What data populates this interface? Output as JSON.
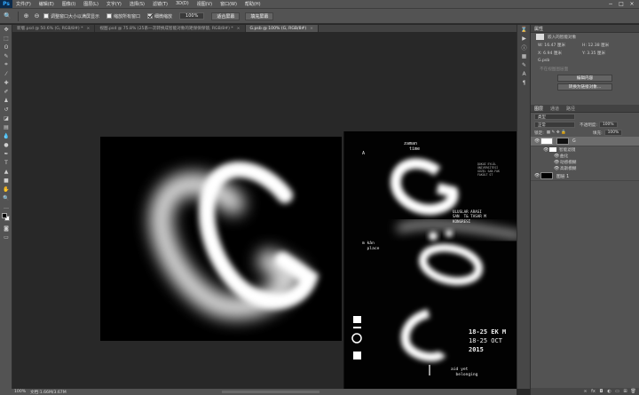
{
  "app": {
    "logo": "Ps"
  },
  "menu": [
    "文件(F)",
    "编辑(E)",
    "图像(I)",
    "图层(L)",
    "文字(Y)",
    "选择(S)",
    "滤镜(T)",
    "3D(D)",
    "视图(V)",
    "窗口(W)",
    "帮助(H)"
  ],
  "window_controls": [
    "−",
    "□",
    "×"
  ],
  "options": {
    "resize_windows": "调整窗口大小以满屏显示",
    "zoom_all": "缩放所有窗口",
    "scrubby_zoom": "细微缩放",
    "zoom_value": "100%",
    "fit_screen": "适合屏幕",
    "fill_screen": "填充屏幕"
  },
  "tabs": [
    {
      "label": "新版.psd @ 50.6% (G, RGB/8#) *",
      "active": false
    },
    {
      "label": "视图.psd @ 75.8% (25系一次转换成智能对象的矩保保保镜, RGB/8#) *",
      "active": false
    },
    {
      "label": "G.psb @ 100% (G, RGB/8#)",
      "active": true
    }
  ],
  "status": {
    "zoom": "100%",
    "doc": "文档:1.66M/3.67M"
  },
  "properties": {
    "title": "属性",
    "subtitle": "嵌入的智能对象",
    "w_label": "W: 16.47 厘米",
    "h_label": "H: 12.38 厘米",
    "x_label": "X: 6.94 厘米",
    "y_label": "Y: 3.35 厘米",
    "file": "G.psb",
    "placeholder": "不在视图图层面",
    "btn_edit": "编辑内容",
    "btn_convert": "转换为链接对象..."
  },
  "layers_panel": {
    "tabs": [
      "图层",
      "通道",
      "路径"
    ],
    "kind": "类型",
    "blend": "正常",
    "opacity_label": "不透明度:",
    "opacity": "100%",
    "lock_label": "锁定:",
    "fill_label": "填充:",
    "fill": "100%",
    "layers": [
      {
        "name": "G",
        "selected": true
      },
      {
        "name": "图层 1",
        "selected": false
      }
    ],
    "filters_header": "智能滤镜",
    "filters": [
      "曲化",
      "动感模糊",
      "高斯模糊"
    ]
  },
  "poster": {
    "zaman": "zaman\n  time",
    "venue": "DOKUZ EYLÜL\nÜNİVERSİTESİ\nGÜZEL SAN.FAK\nFAKÜLT ST",
    "congress_tr": "ULUSLAR ARASI\nSAN  T& TASAR M\nKONGRESİ",
    "mekan": "m kân\n  place",
    "dates_tr": "18-25 EK M",
    "dates_en": "18-25 OCT",
    "year": "2015",
    "aid": "aid yet\n  belonging",
    "letter_a": "A"
  }
}
